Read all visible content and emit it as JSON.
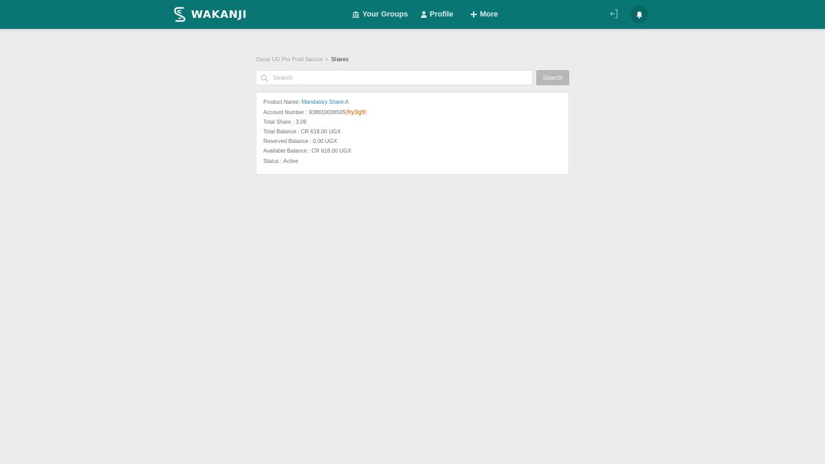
{
  "header": {
    "brand": "WAKANJI",
    "nav": [
      {
        "label": "Your Groups",
        "icon": "bank-icon"
      },
      {
        "label": "Profile",
        "icon": "user-icon"
      },
      {
        "label": "More",
        "icon": "plus-icon"
      }
    ],
    "actions": [
      "logout-icon",
      "bell-icon"
    ]
  },
  "breadcrumb": {
    "parent": "Oscar UG Pre Prod Saccos",
    "separator": ">",
    "current": "Shares"
  },
  "search": {
    "placeholder": "Search",
    "value": "",
    "button_label": "Search"
  },
  "share": {
    "product_label": "Product Name:",
    "product_name": "Mandatory Share A",
    "account_label": "Account Number :",
    "account_number": "938810006505",
    "account_code_open": "[",
    "account_code": "fiy3g9",
    "account_code_close": "]",
    "total_share_label": "Total Share :",
    "total_share": "3.09",
    "total_balance_label": "Total Balance :",
    "total_balance": "CR 618.00 UGX",
    "reserved_balance_label": "Reserved Balance :",
    "reserved_balance": "0.00 UGX",
    "available_balance_label": "Available Balance :",
    "available_balance": "CR 618.00 UGX",
    "status_label": "Status :",
    "status": "Active"
  },
  "colors": {
    "header_bg": "#0a7674",
    "page_bg": "#ececec",
    "link": "#2a86c8",
    "code_accent": "#e08a34",
    "search_button": "#b7b7b7"
  }
}
